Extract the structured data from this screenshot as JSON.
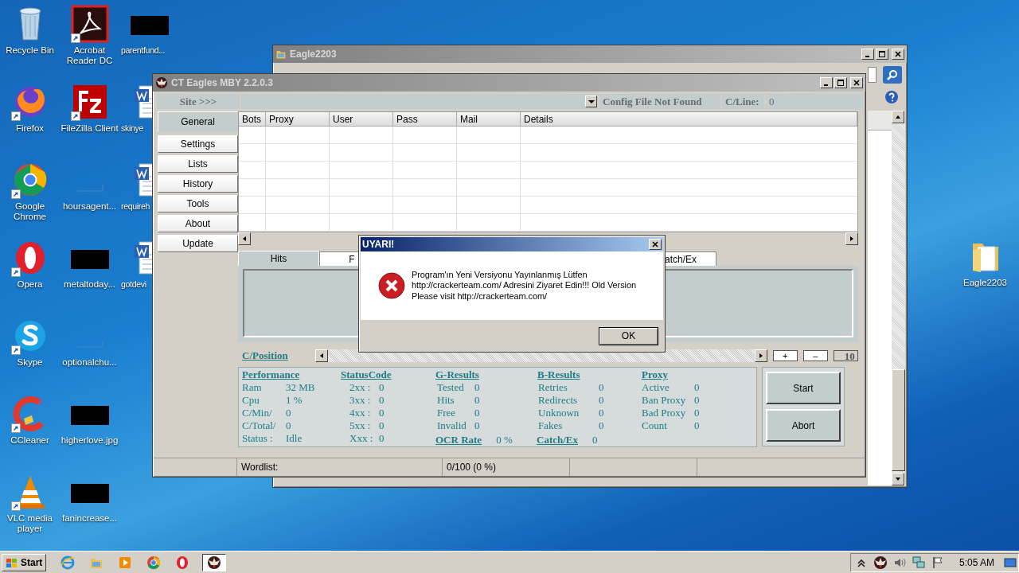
{
  "desktop": {
    "icons": [
      {
        "label": "Recycle Bin",
        "kind": "recycle",
        "shortcut": false
      },
      {
        "label": "Firefox",
        "kind": "firefox",
        "shortcut": true
      },
      {
        "label": "Google\nChrome",
        "kind": "chrome",
        "shortcut": true
      },
      {
        "label": "Opera",
        "kind": "opera",
        "shortcut": true
      },
      {
        "label": "Skype",
        "kind": "skype",
        "shortcut": true
      },
      {
        "label": "CCleaner",
        "kind": "ccleaner",
        "shortcut": true
      },
      {
        "label": "VLC media\nplayer",
        "kind": "vlc",
        "shortcut": true
      },
      {
        "label": "Acrobat\nReader DC",
        "kind": "acrobat",
        "shortcut": true
      },
      {
        "label": "FileZilla Client",
        "kind": "filezilla",
        "shortcut": true
      },
      {
        "label": "hoursagent...",
        "kind": "blank",
        "shortcut": false
      },
      {
        "label": "metaltoday...",
        "kind": "redacted",
        "shortcut": false
      },
      {
        "label": "optionalchu...",
        "kind": "blank",
        "shortcut": false
      },
      {
        "label": "higherlove.jpg",
        "kind": "redacted",
        "shortcut": false
      },
      {
        "label": "fanincrease...",
        "kind": "redacted",
        "shortcut": false
      },
      {
        "label": "parentfund...",
        "kind": "redacted",
        "shortcut": false
      },
      {
        "label": "skinye",
        "kind": "word",
        "shortcut": false
      },
      {
        "label": "requireh",
        "kind": "word",
        "shortcut": false
      },
      {
        "label": "gotdevi",
        "kind": "word",
        "shortcut": false
      }
    ],
    "folder_icon": {
      "label": "Eagle2203",
      "kind": "folder",
      "shortcut": false
    }
  },
  "explorer_window": {
    "title": "Eagle2203"
  },
  "main_window": {
    "title": "CT Eagles MBY 2.2.0.3",
    "site_label": "Site >>>",
    "config_status": "Config File Not Found",
    "cline_label": "C/Line:",
    "cline_value": "0",
    "nav": [
      {
        "label": "General",
        "selected": true
      },
      {
        "label": "Settings",
        "selected": false
      },
      {
        "label": "Lists",
        "selected": false
      },
      {
        "label": "History",
        "selected": false
      },
      {
        "label": "Tools",
        "selected": false
      },
      {
        "label": "About",
        "selected": false
      },
      {
        "label": "Update",
        "selected": false
      }
    ],
    "grid": {
      "columns": [
        "Bots",
        "Proxy",
        "User",
        "Pass",
        "Mail",
        "Details"
      ]
    },
    "tabs": [
      {
        "label": "Hits",
        "selected": true
      },
      {
        "label": "F",
        "selected": false
      },
      {
        "label": "atch/Ex",
        "selected": false
      }
    ],
    "position_label": "C/Position",
    "step_buttons": [
      "+",
      "–"
    ],
    "step_value": "10",
    "stats": [
      {
        "heading": "Performance",
        "rows": [
          {
            "label": "Ram",
            "value": "32 MB",
            "kind": "plain"
          },
          {
            "label": "Cpu",
            "value": "1 %",
            "kind": "plain"
          },
          {
            "label": "C/Min/",
            "value": "0",
            "kind": "plain"
          },
          {
            "label": "C/Total/",
            "value": "0",
            "kind": "plain"
          },
          {
            "label": "Status :",
            "value": "Idle",
            "kind": "plain"
          }
        ]
      },
      {
        "heading": "StatusCode",
        "rows": [
          {
            "label": "2xx :",
            "value": "0",
            "kind": "plain"
          },
          {
            "label": "3xx :",
            "value": "0",
            "kind": "plain"
          },
          {
            "label": "4xx :",
            "value": "0",
            "kind": "plain"
          },
          {
            "label": "5xx :",
            "value": "0",
            "kind": "plain"
          },
          {
            "label": "Xxx :",
            "value": "0",
            "kind": "plain"
          }
        ]
      },
      {
        "heading": "G-Results",
        "rows": [
          {
            "label": "Tested",
            "value": "0",
            "kind": "plain"
          },
          {
            "label": "Hits",
            "value": "0",
            "kind": "plain"
          },
          {
            "label": "Free",
            "value": "0",
            "kind": "plain"
          },
          {
            "label": "Invalid",
            "value": "0",
            "kind": "plain"
          },
          {
            "label": "OCR Rate",
            "value": "0 %",
            "kind": "link"
          }
        ]
      },
      {
        "heading": "B-Results",
        "rows": [
          {
            "label": "Retries",
            "value": "0",
            "kind": "plain"
          },
          {
            "label": "Redirects",
            "value": "0",
            "kind": "plain"
          },
          {
            "label": "Unknown",
            "value": "0",
            "kind": "plain"
          },
          {
            "label": "Fakes",
            "value": "0",
            "kind": "plain"
          },
          {
            "label": "Catch/Ex",
            "value": "0",
            "kind": "link"
          }
        ]
      },
      {
        "heading": "Proxy",
        "rows": [
          {
            "label": "Active",
            "value": "0",
            "kind": "plain"
          },
          {
            "label": "Ban Proxy",
            "value": "0",
            "kind": "plain"
          },
          {
            "label": "Bad Proxy",
            "value": "0",
            "kind": "plain"
          },
          {
            "label": "Count",
            "value": "0",
            "kind": "plain"
          }
        ]
      }
    ],
    "actions": [
      "Start",
      "Abort"
    ],
    "status_bar": [
      "Wordlist:",
      "0/100 (0 %)"
    ]
  },
  "dialog": {
    "title": "UYARI!",
    "message": "Program'ın Yeni Versiyonu Yayınlanmış Lütfen\nhttp://crackerteam.com/ Adresini Ziyaret Edin!!! Old Version\nPlease visit http://crackerteam.com/",
    "button": "OK"
  },
  "taskbar": {
    "start": "Start",
    "apps": [
      {
        "kind": "ie",
        "selected": false
      },
      {
        "kind": "folder",
        "selected": false
      },
      {
        "kind": "media",
        "selected": false
      },
      {
        "kind": "chrome",
        "selected": false
      },
      {
        "kind": "opera",
        "selected": false
      },
      {
        "kind": "eagle",
        "selected": true
      }
    ],
    "tray": [
      {
        "kind": "caret"
      },
      {
        "kind": "eagle"
      },
      {
        "kind": "speaker"
      },
      {
        "kind": "network"
      },
      {
        "kind": "flag"
      }
    ],
    "clock": "5:05 AM"
  }
}
